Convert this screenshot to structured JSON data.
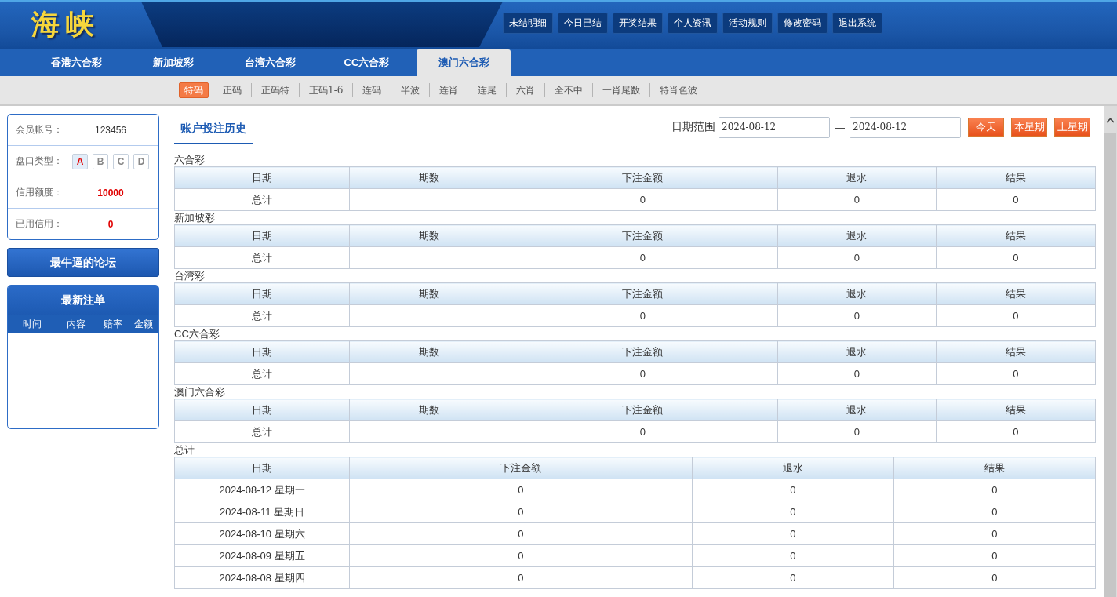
{
  "header": {
    "logo": "海峡",
    "nav": [
      "未结明细",
      "今日已结",
      "开奖结果",
      "个人资讯",
      "活动规则",
      "修改密码",
      "退出系统"
    ]
  },
  "lottery_tabs": [
    {
      "label": "香港六合彩",
      "selected": false
    },
    {
      "label": "新加坡彩",
      "selected": false
    },
    {
      "label": "台湾六合彩",
      "selected": false
    },
    {
      "label": "CC六合彩",
      "selected": false
    },
    {
      "label": "澳门六合彩",
      "selected": true
    }
  ],
  "play_tabs": [
    {
      "label": "特码",
      "selected": true
    },
    {
      "label": "正码",
      "selected": false
    },
    {
      "label": "正码特",
      "selected": false
    },
    {
      "label": "正码1-6",
      "selected": false
    },
    {
      "label": "连码",
      "selected": false
    },
    {
      "label": "半波",
      "selected": false
    },
    {
      "label": "连肖",
      "selected": false
    },
    {
      "label": "连尾",
      "selected": false
    },
    {
      "label": "六肖",
      "selected": false
    },
    {
      "label": "全不中",
      "selected": false
    },
    {
      "label": "一肖尾数",
      "selected": false
    },
    {
      "label": "特肖色波",
      "selected": false
    }
  ],
  "account": {
    "member_label": "会员帐号：",
    "member_id": "123456",
    "plate_label": "盘口类型：",
    "plates": [
      {
        "label": "A",
        "selected": true
      },
      {
        "label": "B",
        "selected": false
      },
      {
        "label": "C",
        "selected": false
      },
      {
        "label": "D",
        "selected": false
      }
    ],
    "credit_label": "信用额度：",
    "credit": "10000",
    "used_label": "已用信用：",
    "used": "0"
  },
  "forum_button": "最牛逼的论坛",
  "latest_bets": {
    "title": "最新注单",
    "columns": [
      "时间",
      "内容",
      "赔率",
      "金额"
    ]
  },
  "history": {
    "title": "账户投注历史",
    "date_range": {
      "label": "日期范围",
      "from": "2024-08-12",
      "separator": "—",
      "to": "2024-08-12"
    },
    "buttons": [
      "今天",
      "本星期",
      "上星期"
    ],
    "sections": [
      {
        "name": "六合彩",
        "columns": [
          "日期",
          "期数",
          "下注金额",
          "退水",
          "结果"
        ],
        "rows": [
          {
            "date": "总计",
            "amount": "0",
            "rebate": "0",
            "result": "0"
          }
        ]
      },
      {
        "name": "新加坡彩",
        "columns": [
          "日期",
          "期数",
          "下注金额",
          "退水",
          "结果"
        ],
        "rows": [
          {
            "date": "总计",
            "amount": "0",
            "rebate": "0",
            "result": "0"
          }
        ]
      },
      {
        "name": "台湾彩",
        "columns": [
          "日期",
          "期数",
          "下注金额",
          "退水",
          "结果"
        ],
        "rows": [
          {
            "date": "总计",
            "amount": "0",
            "rebate": "0",
            "result": "0"
          }
        ]
      },
      {
        "name": "CC六合彩",
        "columns": [
          "日期",
          "期数",
          "下注金额",
          "退水",
          "结果"
        ],
        "rows": [
          {
            "date": "总计",
            "amount": "0",
            "rebate": "0",
            "result": "0"
          }
        ]
      },
      {
        "name": "澳门六合彩",
        "columns": [
          "日期",
          "期数",
          "下注金额",
          "退水",
          "结果"
        ],
        "rows": [
          {
            "date": "总计",
            "amount": "0",
            "rebate": "0",
            "result": "0"
          }
        ]
      }
    ],
    "summary": {
      "name": "总计",
      "columns": [
        "日期",
        "下注金额",
        "退水",
        "结果"
      ],
      "rows": [
        {
          "date": "2024-08-12 星期一",
          "amount": "0",
          "rebate": "0",
          "result": "0"
        },
        {
          "date": "2024-08-11 星期日",
          "amount": "0",
          "rebate": "0",
          "result": "0"
        },
        {
          "date": "2024-08-10 星期六",
          "amount": "0",
          "rebate": "0",
          "result": "0"
        },
        {
          "date": "2024-08-09 星期五",
          "amount": "0",
          "rebate": "0",
          "result": "0"
        },
        {
          "date": "2024-08-08 星期四",
          "amount": "0",
          "rebate": "0",
          "result": "0"
        }
      ]
    }
  }
}
